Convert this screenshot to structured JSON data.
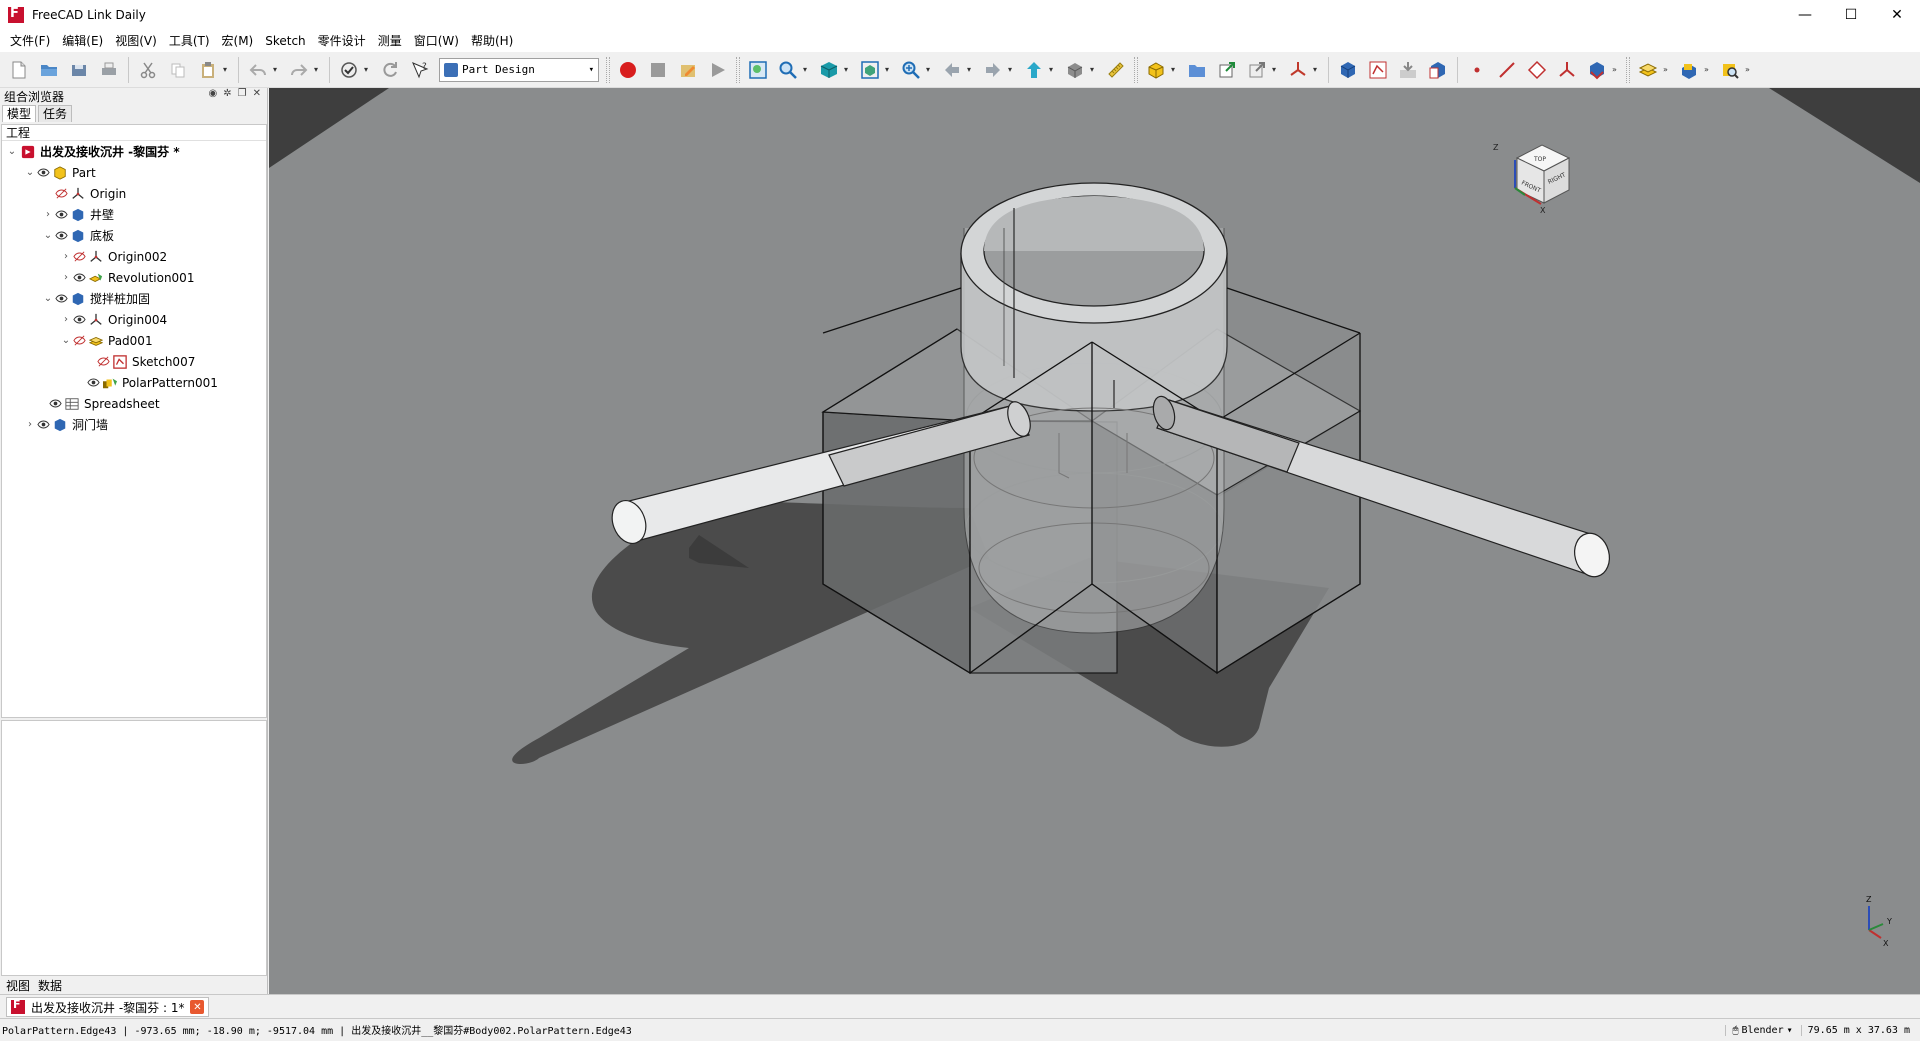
{
  "window": {
    "title": "FreeCAD Link Daily",
    "minimize_glyph": "—",
    "maximize_glyph": "☐",
    "close_glyph": "✕"
  },
  "menu": {
    "items": [
      "文件(F)",
      "编辑(E)",
      "视图(V)",
      "工具(T)",
      "宏(M)",
      "Sketch",
      "零件设计",
      "测量",
      "窗口(W)",
      "帮助(H)"
    ]
  },
  "toolbar": {
    "workbench": "Part Design"
  },
  "combo_view": {
    "title": "组合浏览器",
    "tabs": [
      "模型",
      "任务"
    ],
    "tree_header": "工程",
    "bottom_tabs": [
      "视图",
      "数据"
    ]
  },
  "tree": [
    {
      "label": "出发及接收沉井 -黎国芬 *",
      "expander": "⌄",
      "visible": "none",
      "icon": "document-icon"
    },
    {
      "label": "Part",
      "expander": "⌄",
      "visible": "eye",
      "icon": "part-icon"
    },
    {
      "label": "Origin",
      "expander": "",
      "visible": "hidden",
      "icon": "origin-icon"
    },
    {
      "label": "井壁",
      "expander": "›",
      "visible": "eye",
      "icon": "body-icon"
    },
    {
      "label": "底板",
      "expander": "⌄",
      "visible": "eye",
      "icon": "body-icon"
    },
    {
      "label": "Origin002",
      "expander": "›",
      "visible": "hidden",
      "icon": "origin-icon"
    },
    {
      "label": "Revolution001",
      "expander": "›",
      "visible": "eye",
      "icon": "revolution-icon"
    },
    {
      "label": "搅拌桩加固",
      "expander": "⌄",
      "visible": "eye",
      "icon": "body-icon"
    },
    {
      "label": "Origin004",
      "expander": "›",
      "visible": "eye",
      "icon": "origin-icon"
    },
    {
      "label": "Pad001",
      "expander": "⌄",
      "visible": "hidden",
      "icon": "pad-icon"
    },
    {
      "label": "Sketch007",
      "expander": "",
      "visible": "hidden",
      "icon": "sketch-icon"
    },
    {
      "label": "PolarPattern001",
      "expander": "",
      "visible": "eye",
      "icon": "polar-pattern-icon"
    },
    {
      "label": "Spreadsheet",
      "expander": "",
      "visible": "eye",
      "icon": "spreadsheet-icon"
    },
    {
      "label": "洞门墙",
      "expander": "›",
      "visible": "eye",
      "icon": "body-icon"
    }
  ],
  "navcube": {
    "top": "TOP",
    "front": "FRONT",
    "right": "RIGHT",
    "axis_z": "Z",
    "axis_x": "X",
    "axis_y": "Y"
  },
  "doc_tabs": [
    {
      "label": "出发及接收沉井 -黎国芬 : 1*",
      "close_glyph": "✕"
    }
  ],
  "statusbar": {
    "message": "PolarPattern.Edge43 | -973.65 mm; -18.90 m; -9517.04 mm | 出发及接收沉井__黎国芬#Body002.PolarPattern.Edge43",
    "nav_style": "Blender",
    "dimensions": "79.65 m x 37.63 m"
  },
  "colors": {
    "viewport_bg": "#8a8c8d",
    "accent_red": "#c8102e",
    "close_tab": "#e8582f"
  }
}
